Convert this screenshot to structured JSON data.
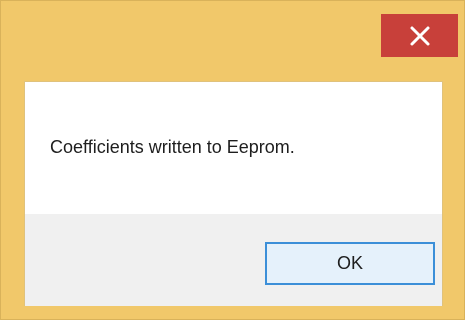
{
  "dialog": {
    "message": "Coefficients written to Eeprom.",
    "ok_label": "OK",
    "close_icon": "close-icon",
    "colors": {
      "frame": "#f1c86a",
      "close_button": "#c8403a",
      "button_bar": "#f0f0f0",
      "ok_border": "#3c8fd8",
      "ok_fill": "#e5f1fb"
    }
  }
}
